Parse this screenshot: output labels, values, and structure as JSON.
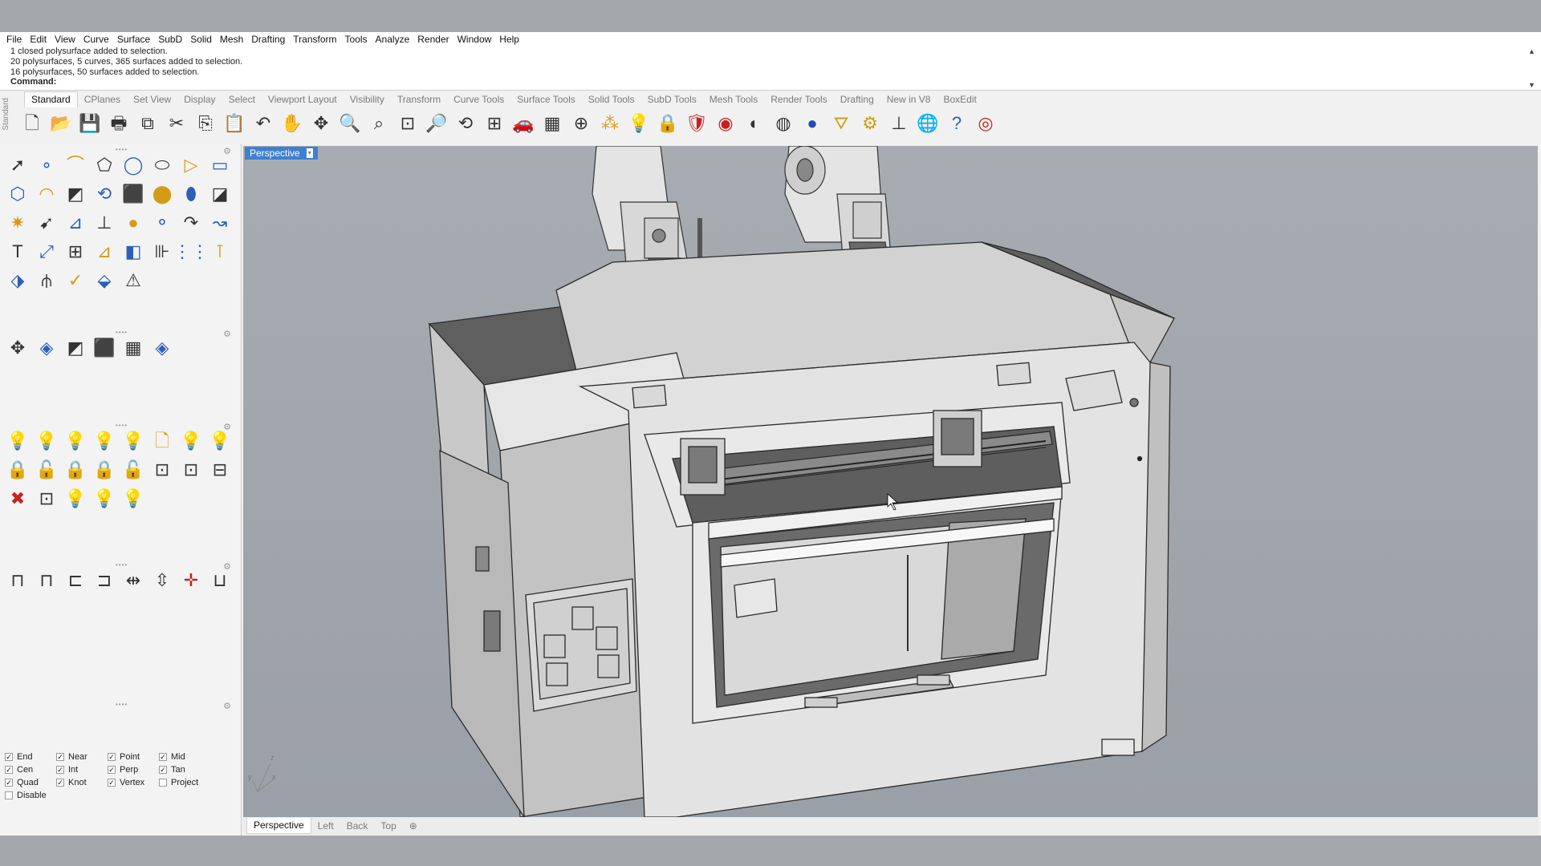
{
  "menu": [
    "File",
    "Edit",
    "View",
    "Curve",
    "Surface",
    "SubD",
    "Solid",
    "Mesh",
    "Drafting",
    "Transform",
    "Tools",
    "Analyze",
    "Render",
    "Window",
    "Help"
  ],
  "command_history": [
    "1 closed polysurface added to selection.",
    "20 polysurfaces, 5 curves, 365 surfaces added to selection.",
    "16 polysurfaces, 50 surfaces added to selection."
  ],
  "command_prompt": "Command:",
  "toolbar_tabs": [
    "Standard",
    "CPlanes",
    "Set View",
    "Display",
    "Select",
    "Viewport Layout",
    "Visibility",
    "Transform",
    "Curve Tools",
    "Surface Tools",
    "Solid Tools",
    "SubD Tools",
    "Mesh Tools",
    "Render Tools",
    "Drafting",
    "New in V8",
    "BoxEdit"
  ],
  "sidebar_label": "Standard",
  "standard_icons": [
    {
      "name": "new-icon",
      "glyph": "🗋"
    },
    {
      "name": "open-icon",
      "glyph": "📂"
    },
    {
      "name": "save-icon",
      "glyph": "💾"
    },
    {
      "name": "print-icon",
      "glyph": "🖶"
    },
    {
      "name": "export-icon",
      "glyph": "⧉"
    },
    {
      "name": "cut-icon",
      "glyph": "✂"
    },
    {
      "name": "copy-icon",
      "glyph": "⎘"
    },
    {
      "name": "paste-icon",
      "glyph": "📋"
    },
    {
      "name": "undo-icon",
      "glyph": "↶"
    },
    {
      "name": "pan-icon",
      "glyph": "✋"
    },
    {
      "name": "rotate-view-icon",
      "glyph": "✥"
    },
    {
      "name": "zoom-icon",
      "glyph": "🔍"
    },
    {
      "name": "zoom-window-icon",
      "glyph": "⌕"
    },
    {
      "name": "zoom-extents-icon",
      "glyph": "⊡"
    },
    {
      "name": "zoom-selected-icon",
      "glyph": "🔎"
    },
    {
      "name": "undo-view-icon",
      "glyph": "⟲"
    },
    {
      "name": "viewport-layout-icon",
      "glyph": "⊞"
    },
    {
      "name": "car-icon",
      "glyph": "🚗"
    },
    {
      "name": "grid-icon",
      "glyph": "▦"
    },
    {
      "name": "osnap-icon",
      "glyph": "⊕"
    },
    {
      "name": "points-icon",
      "glyph": "⁂"
    },
    {
      "name": "light-icon",
      "glyph": "💡"
    },
    {
      "name": "lock-icon",
      "glyph": "🔒"
    },
    {
      "name": "material-icon",
      "glyph": "🛡"
    },
    {
      "name": "color-wheel-icon",
      "glyph": "◉"
    },
    {
      "name": "shaded-sphere-icon",
      "glyph": "◐"
    },
    {
      "name": "rendered-sphere-icon",
      "glyph": "◍"
    },
    {
      "name": "render-icon",
      "glyph": "●"
    },
    {
      "name": "filter-icon",
      "glyph": "⛛"
    },
    {
      "name": "options-gear-icon",
      "glyph": "⚙"
    },
    {
      "name": "dimension-icon",
      "glyph": "⊥"
    },
    {
      "name": "globe-icon",
      "glyph": "🌐"
    },
    {
      "name": "help-icon",
      "glyph": "?"
    },
    {
      "name": "rhino-icon",
      "glyph": "◎"
    }
  ],
  "left_groups": {
    "main": [
      [
        "➚",
        "∘",
        "⌒",
        "⬠",
        "◯",
        "⬭",
        "▷",
        "▭"
      ],
      [
        "⬡",
        "◠",
        "◩",
        "⟲",
        "⬛",
        "⬤",
        "⬮",
        "◪"
      ],
      [
        "✷",
        "➹",
        "⊿",
        "⊥",
        "●",
        "⚬",
        "↷",
        "↝"
      ],
      [
        "T",
        "⤢",
        "⊞",
        "⊿",
        "◧",
        "⊪",
        "⋮⋮",
        "⊺"
      ],
      [
        "⬗",
        "⫛",
        "✓",
        "⬙",
        "⚠"
      ]
    ],
    "view": [
      "✥",
      "◈",
      "◩",
      "⬛",
      "▦",
      "◈"
    ],
    "lights": [
      [
        "💡",
        "💡",
        "💡",
        "💡",
        "💡",
        "🗋",
        "💡",
        "💡"
      ],
      [
        "🔒",
        "🔓",
        "🔒",
        "🔒",
        "🔓",
        "⊡",
        "⊡",
        "⊟"
      ],
      [
        "✖",
        "⊡",
        "💡",
        "💡",
        "💡"
      ]
    ],
    "align": [
      "⊓",
      "⊓",
      "⊏",
      "⊐",
      "⇹",
      "⇳",
      "✛",
      "⊔"
    ]
  },
  "osnaps": [
    [
      {
        "label": "End",
        "checked": true
      },
      {
        "label": "Near",
        "checked": true
      },
      {
        "label": "Point",
        "checked": true
      },
      {
        "label": "Mid",
        "checked": true
      }
    ],
    [
      {
        "label": "Cen",
        "checked": true
      },
      {
        "label": "Int",
        "checked": true
      },
      {
        "label": "Perp",
        "checked": true
      },
      {
        "label": "Tan",
        "checked": true
      }
    ],
    [
      {
        "label": "Quad",
        "checked": true
      },
      {
        "label": "Knot",
        "checked": true
      },
      {
        "label": "Vertex",
        "checked": true
      },
      {
        "label": "Project",
        "checked": false
      }
    ],
    [
      {
        "label": "Disable",
        "checked": false
      }
    ]
  ],
  "viewport": {
    "title": "Perspective"
  },
  "viewport_tabs": [
    {
      "label": "Perspective",
      "active": true
    },
    {
      "label": "Left",
      "active": false
    },
    {
      "label": "Back",
      "active": false
    },
    {
      "label": "Top",
      "active": false
    },
    {
      "label": "⊕",
      "active": false
    }
  ],
  "axis": {
    "x": "x",
    "y": "y",
    "z": "z"
  },
  "colors": {
    "viewport_bg": "#9da3aa",
    "active_tab": "#3f7fd0",
    "model_light": "#d4d4d4",
    "model_dark": "#5f5f5f"
  }
}
